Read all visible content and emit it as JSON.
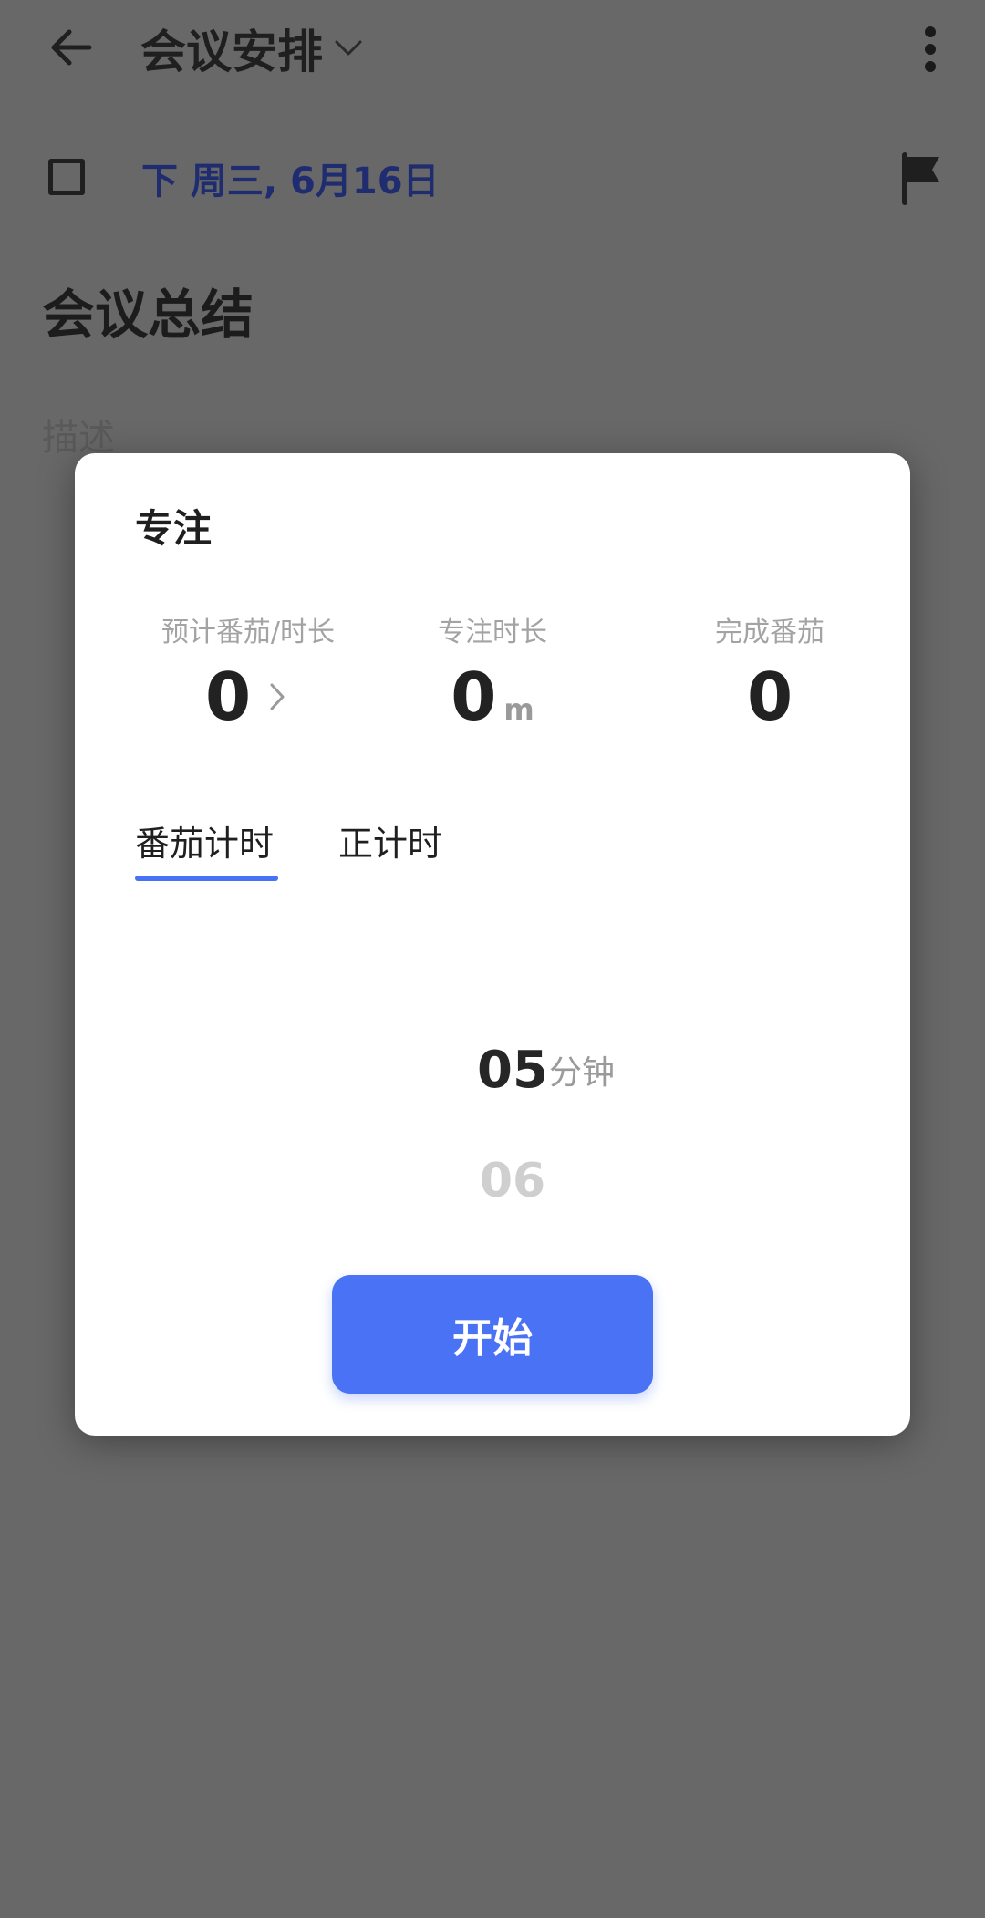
{
  "header": {
    "title": "会议安排",
    "back_icon": "arrow-left-icon",
    "dropdown_icon": "chevron-down-icon",
    "more_icon": "more-vertical-icon"
  },
  "task": {
    "due_date": "下 周三, 6月16日",
    "flag_icon": "flag-icon",
    "title": "会议总结",
    "description_placeholder": "描述"
  },
  "focus_dialog": {
    "title": "专注",
    "stats": [
      {
        "label": "预计番茄/时长",
        "value": "0",
        "unit": ""
      },
      {
        "label": "专注时长",
        "value": "0",
        "unit": "m"
      },
      {
        "label": "完成番茄",
        "value": "0",
        "unit": ""
      }
    ],
    "tabs": [
      {
        "label": "番茄计时",
        "active": true
      },
      {
        "label": "正计时",
        "active": false
      }
    ],
    "picker": {
      "current": "05",
      "next": "06",
      "unit": "分钟"
    },
    "start_label": "开始"
  },
  "colors": {
    "accent": "#4a72f5",
    "dim_background": "#686868",
    "date_text": "#1f2d70"
  }
}
